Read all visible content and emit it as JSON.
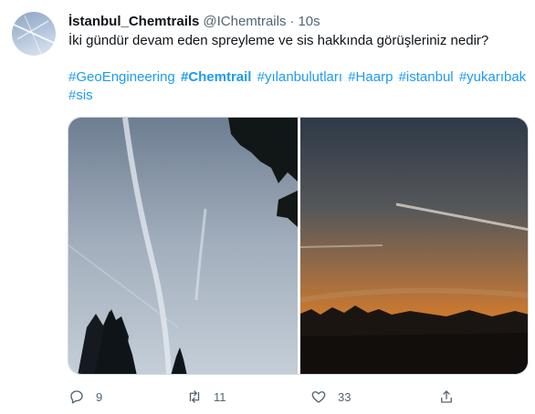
{
  "tweet": {
    "display_name": "İstanbul_Chemtrails",
    "handle": "@IChemtrails",
    "separator": "·",
    "time": "10s",
    "text": "İki gündür devam eden spreyleme ve sis hakkında görüşleriniz nedir?",
    "hashtags": [
      "#GeoEngineering",
      "#Chemtrail",
      "#yılanbulutları",
      "#Haarp",
      "#istanbul",
      "#yukarıbak",
      "#sis"
    ]
  },
  "actions": {
    "reply_count": "9",
    "retweet_count": "11",
    "like_count": "33"
  },
  "colors": {
    "link": "#1d9bf0",
    "text_secondary": "#536471"
  },
  "icons": [
    "reply-icon",
    "retweet-icon",
    "like-icon",
    "share-icon"
  ]
}
